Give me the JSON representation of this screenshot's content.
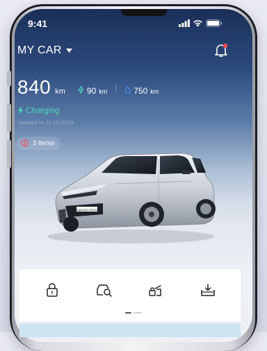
{
  "status": {
    "time": "9:41"
  },
  "header": {
    "title": "MY CAR"
  },
  "range": {
    "total": "840",
    "unit": "km",
    "electric": "90",
    "electric_unit": "km",
    "fuel": "750",
    "fuel_unit": "km"
  },
  "charging": {
    "label": "Charging",
    "updated": "Updated on 12.22 10:23"
  },
  "alerts": {
    "label": "3 Items"
  },
  "car": {
    "plate": "CHANGAN DEEPAL"
  },
  "controls": [
    {
      "icon": "lock-icon"
    },
    {
      "icon": "car-search-icon"
    },
    {
      "icon": "trunk-unlock-icon"
    },
    {
      "icon": "download-tray-icon"
    }
  ],
  "colors": {
    "accent_green": "#4ad8b6",
    "accent_blue": "#3d8ff5",
    "alert_red": "#ff4d4f"
  }
}
